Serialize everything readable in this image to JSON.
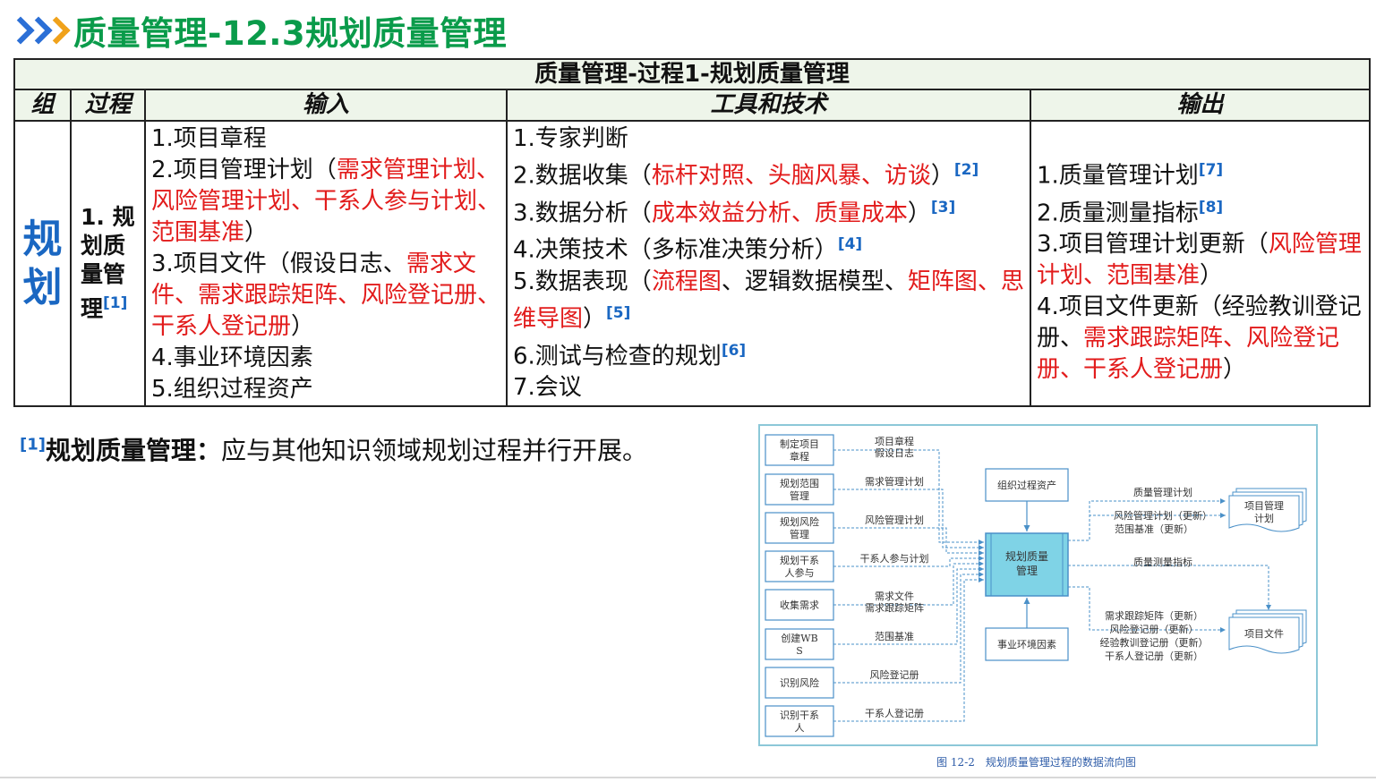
{
  "page": {
    "title": "质量管理-12.3规划质量管理"
  },
  "table": {
    "title": "质量管理-过程1-规划质量管理",
    "headers": {
      "group": "组",
      "process": "过程",
      "inputs": "输入",
      "tools": "工具和技术",
      "outputs": "输出"
    },
    "group": "规划",
    "process": "1. 规划质量管理",
    "process_ref": "[1]",
    "inputs": [
      {
        "parts": [
          {
            "t": "1.项目章程"
          }
        ]
      },
      {
        "parts": [
          {
            "t": "2.项目管理计划（"
          },
          {
            "t": "需求管理计划、风险管理计划、干系人参与计划、范围基准",
            "red": true
          },
          {
            "t": "）"
          }
        ]
      },
      {
        "parts": [
          {
            "t": "3.项目文件（假设日志、"
          },
          {
            "t": "需求文件、需求跟踪矩阵、风险登记册、干系人登记册",
            "red": true
          },
          {
            "t": "）"
          }
        ]
      },
      {
        "parts": [
          {
            "t": "4.事业环境因素"
          }
        ]
      },
      {
        "parts": [
          {
            "t": "5.组织过程资产"
          }
        ]
      }
    ],
    "tools": [
      {
        "parts": [
          {
            "t": "1.专家判断"
          }
        ]
      },
      {
        "parts": [
          {
            "t": "2.数据收集（"
          },
          {
            "t": "标杆对照、头脑风暴、访谈",
            "red": true
          },
          {
            "t": "）"
          }
        ],
        "ref": "[2]"
      },
      {
        "parts": [
          {
            "t": "3.数据分析（"
          },
          {
            "t": "成本效益分析、质量成本",
            "red": true
          },
          {
            "t": "）"
          }
        ],
        "ref": "[3]"
      },
      {
        "parts": [
          {
            "t": "4.决策技术（多标准决策分析）"
          }
        ],
        "ref": "[4]"
      },
      {
        "parts": [
          {
            "t": "5.数据表现（"
          },
          {
            "t": "流程图",
            "red": true
          },
          {
            "t": "、逻辑数据模型、"
          },
          {
            "t": "矩阵图、思维导图",
            "red": true
          },
          {
            "t": "）"
          }
        ],
        "ref": "[5]"
      },
      {
        "parts": [
          {
            "t": "6.测试与检查的规划"
          }
        ],
        "ref": "[6]"
      },
      {
        "parts": [
          {
            "t": "7.会议"
          }
        ]
      }
    ],
    "outputs": [
      {
        "parts": [
          {
            "t": "1.质量管理计划"
          }
        ],
        "ref": "[7]"
      },
      {
        "parts": [
          {
            "t": "2.质量测量指标"
          }
        ],
        "ref": "[8]"
      },
      {
        "parts": [
          {
            "t": "3.项目管理计划更新（"
          },
          {
            "t": "风险管理计划、范围基准",
            "red": true
          },
          {
            "t": "）"
          }
        ]
      },
      {
        "parts": [
          {
            "t": "4.项目文件更新（经验教训登记册、"
          },
          {
            "t": "需求跟踪矩阵、风险登记册、干系人登记册",
            "red": true
          },
          {
            "t": "）"
          }
        ]
      }
    ]
  },
  "note": {
    "ref": "[1]",
    "term": "规划质量管理：",
    "text": "应与其他知识领域规划过程并行开展。"
  },
  "diagram": {
    "sources": [
      {
        "name": "制定项目章程",
        "labels": [
          "项目章程",
          "假设日志"
        ]
      },
      {
        "name": "规划范围管理",
        "labels": [
          "需求管理计划"
        ]
      },
      {
        "name": "规划风险管理",
        "labels": [
          "风险管理计划"
        ]
      },
      {
        "name": "规划干系人参与",
        "labels": [
          "干系人参与计划"
        ]
      },
      {
        "name": "收集需求",
        "labels": [
          "需求文件",
          "需求跟踪矩阵"
        ]
      },
      {
        "name": "创建WBS",
        "labels": [
          "范围基准"
        ]
      },
      {
        "name": "识别风险",
        "labels": [
          "风险登记册"
        ]
      },
      {
        "name": "识别干系人",
        "labels": [
          "干系人登记册"
        ]
      }
    ],
    "org_assets": "组织过程资产",
    "center": "规划质量管理",
    "env_factors": "事业环境因素",
    "out_labels_top": [
      "质量管理计划",
      "风险管理计划（更新）",
      "范围基准（更新）"
    ],
    "out_doc_top": "项目管理计划",
    "out_label_mid": "质量测量指标",
    "out_labels_bottom": [
      "需求跟踪矩阵（更新）",
      "风险登记册（更新）",
      "经验教训登记册（更新）",
      "干系人登记册（更新）"
    ],
    "out_doc_bottom": "项目文件",
    "caption": "图 12-2　规划质量管理过程的数据流向图"
  }
}
